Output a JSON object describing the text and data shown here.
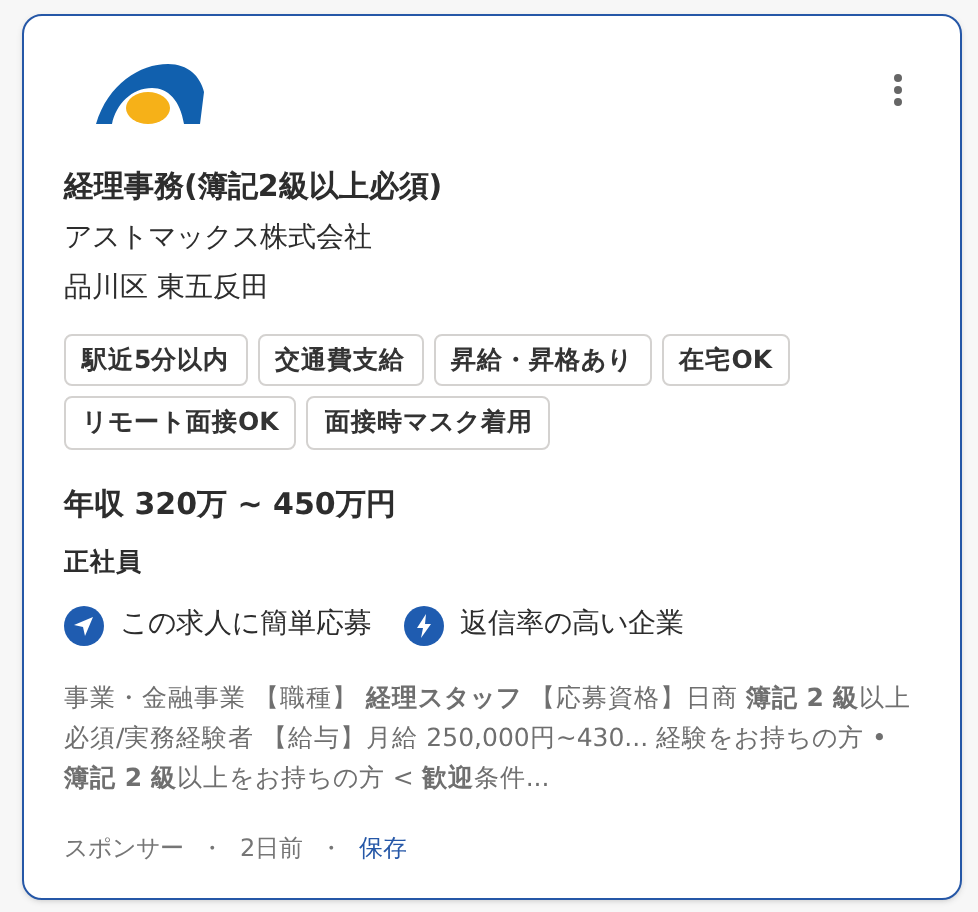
{
  "job": {
    "title": "経理事務(簿記2級以上必須)",
    "company": "アストマックス株式会社",
    "location": "品川区 東五反田",
    "tags": [
      "駅近5分以内",
      "交通費支給",
      "昇給・昇格あり",
      "在宅OK",
      "リモート面接OK",
      "面接時マスク着用"
    ],
    "salary": "年収 320万 ~ 450万円",
    "employment_type": "正社員",
    "features": [
      {
        "kind": "send",
        "label": "この求人に簡単応募"
      },
      {
        "kind": "bolt",
        "label": "返信率の高い企業"
      }
    ],
    "snippet": "事業・金融事業 【職種】 **経理スタッフ** 【応募資格】日商 **簿記 2 級**以上必須/実務経験者 【給与】月給 250,000円~430... 経験をお持ちの方 • **簿記 2 級**以上をお持ちの方 < **歓迎**条件...",
    "footer": [
      {
        "kind": "text",
        "label": "スポンサー"
      },
      {
        "kind": "sep",
        "label": "・"
      },
      {
        "kind": "text",
        "label": "2日前"
      },
      {
        "kind": "sep",
        "label": "・"
      },
      {
        "kind": "link",
        "label": "保存"
      }
    ]
  }
}
